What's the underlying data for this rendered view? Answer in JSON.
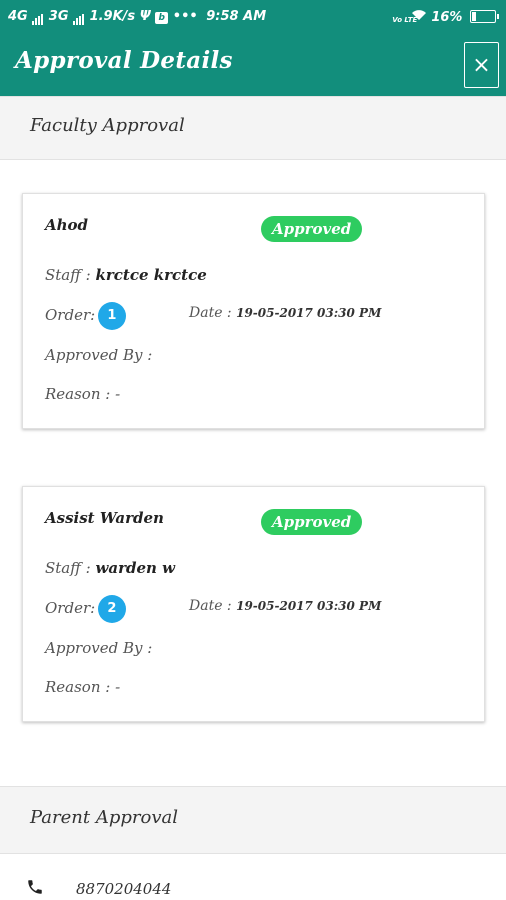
{
  "status_bar": {
    "network1": "4G",
    "network2": "3G",
    "speed": "1.9K/s",
    "time": "9:58 AM",
    "volte": "Vo LTE",
    "battery": "16%",
    "battery_level": 0.16,
    "app_badge": "b",
    "dots": "•••",
    "usb": "Ψ"
  },
  "appbar": {
    "title": "Approval Details",
    "close_label": "×"
  },
  "faculty_section": {
    "title": "Faculty Approval",
    "cards": [
      {
        "name": "Ahod",
        "status": "Approved",
        "staff_label": "Staff :",
        "staff": "krctce krctce",
        "order_label": "Order:",
        "order": "1",
        "date_label": "Date :",
        "date": "19-05-2017 03:30 PM",
        "approved_by_label": "Approved By :",
        "reason_label": "Reason :",
        "reason": "-"
      },
      {
        "name": "Assist Warden",
        "status": "Approved",
        "staff_label": "Staff :",
        "staff": "warden w",
        "order_label": "Order:",
        "order": "2",
        "date_label": "Date :",
        "date": "19-05-2017 03:30 PM",
        "approved_by_label": "Approved By :",
        "reason_label": "Reason :",
        "reason": "-"
      }
    ]
  },
  "parent_section": {
    "title": "Parent Approval",
    "phone": "8870204044"
  },
  "colors": {
    "primary": "#128e7c",
    "approved": "#2ecc60",
    "order_badge": "#20a8e8"
  }
}
